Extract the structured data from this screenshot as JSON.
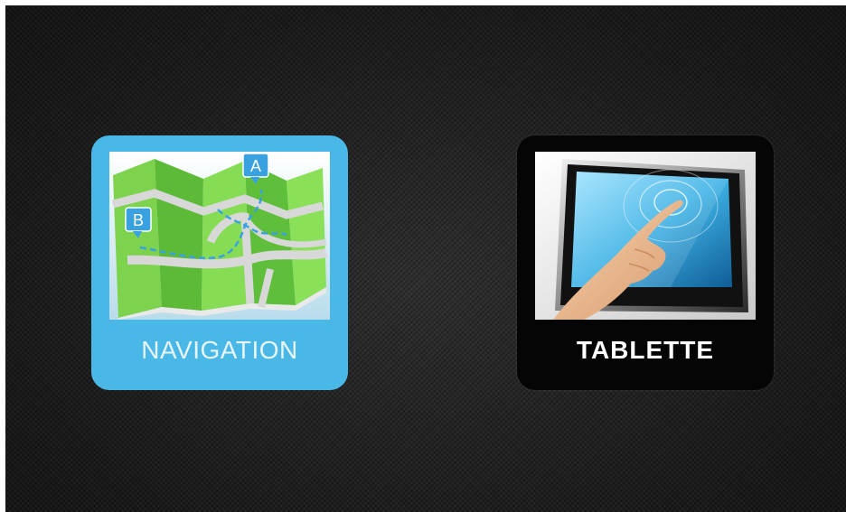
{
  "apps": [
    {
      "label": "NAVIGATION",
      "icon": "map-icon",
      "accent": "#4ab8e6",
      "markers": [
        "A",
        "B"
      ]
    },
    {
      "label": "TABLETTE",
      "icon": "touch-tablet-icon",
      "accent": "#050505"
    }
  ]
}
